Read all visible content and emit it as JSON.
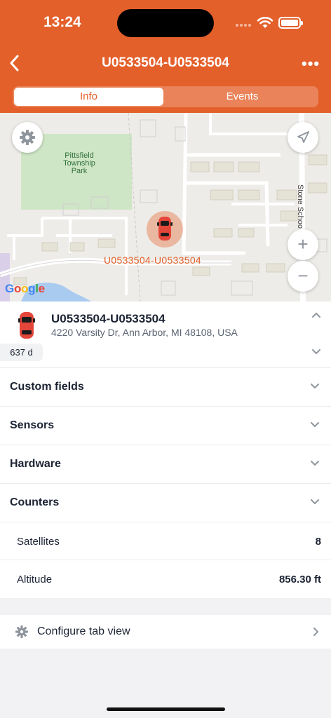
{
  "status_bar": {
    "time": "13:24"
  },
  "header": {
    "title": "U0533504-U0533504",
    "more_label": "•••",
    "tabs": [
      {
        "label": "Info",
        "active": true
      },
      {
        "label": "Events",
        "active": false
      }
    ]
  },
  "map": {
    "park_label": "Pittsfield Township Park",
    "street_label": "Stone Schoo",
    "unit_label": "U0533504-U0533504",
    "provider": "Google",
    "zoom_in": "+",
    "zoom_out": "−"
  },
  "unit": {
    "name": "U0533504-U0533504",
    "address": "4220 Varsity Dr, Ann Arbor, MI 48108, USA",
    "age": "637 d"
  },
  "sections": [
    {
      "label": "Custom fields"
    },
    {
      "label": "Sensors"
    },
    {
      "label": "Hardware"
    },
    {
      "label": "Counters"
    }
  ],
  "counters": [
    {
      "label": "Satellites",
      "value": "8"
    },
    {
      "label": "Altitude",
      "value": "856.30 ft"
    }
  ],
  "configure": {
    "label": "Configure tab view"
  },
  "colors": {
    "accent": "#e4602b",
    "text": "#1b2333",
    "muted": "#5b6472"
  }
}
